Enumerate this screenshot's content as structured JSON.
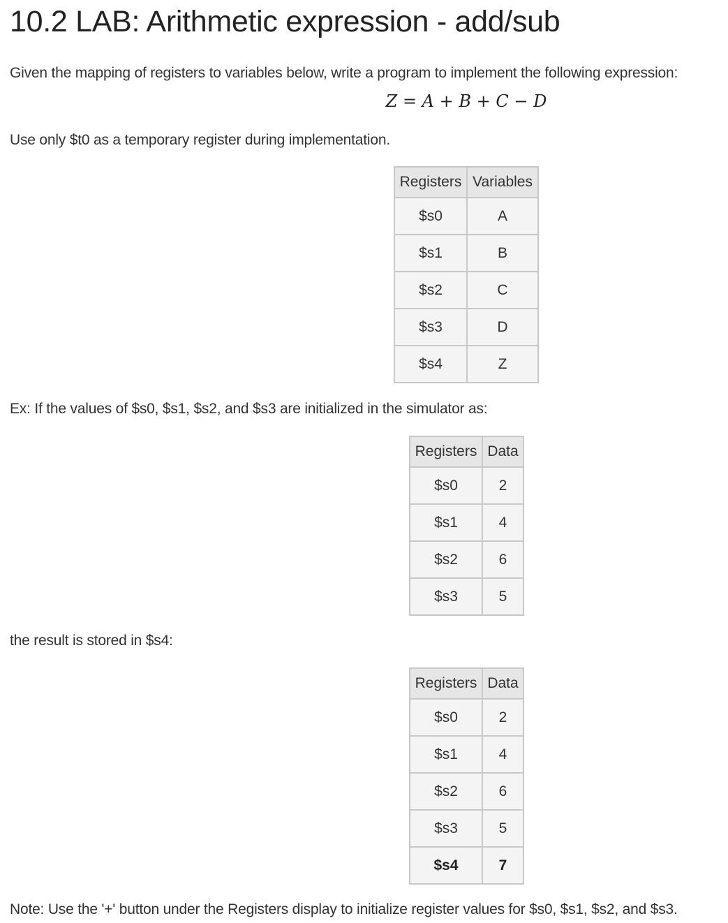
{
  "title": "10.2 LAB: Arithmetic expression - add/sub",
  "intro": "Given the mapping of registers to variables below, write a program to implement the following expression:",
  "formula": "Z = A + B + C − D",
  "temp_note": "Use only $t0 as a temporary register during implementation.",
  "mapping_table": {
    "headers": [
      "Registers",
      "Variables"
    ],
    "rows": [
      [
        "$s0",
        "A"
      ],
      [
        "$s1",
        "B"
      ],
      [
        "$s2",
        "C"
      ],
      [
        "$s3",
        "D"
      ],
      [
        "$s4",
        "Z"
      ]
    ]
  },
  "example_text": "Ex: If the values of $s0, $s1, $s2, and $s3 are initialized in the simulator as:",
  "init_table": {
    "headers": [
      "Registers",
      "Data"
    ],
    "rows": [
      [
        "$s0",
        "2"
      ],
      [
        "$s1",
        "4"
      ],
      [
        "$s2",
        "6"
      ],
      [
        "$s3",
        "5"
      ]
    ]
  },
  "result_text": "the result is stored in $s4:",
  "result_table": {
    "headers": [
      "Registers",
      "Data"
    ],
    "rows": [
      [
        "$s0",
        "2"
      ],
      [
        "$s1",
        "4"
      ],
      [
        "$s2",
        "6"
      ],
      [
        "$s3",
        "5"
      ],
      [
        "$s4",
        "7"
      ]
    ]
  },
  "note": "Note: Use the '+' button under the Registers display to initialize register values for $s0, $s1, $s2, and $s3."
}
